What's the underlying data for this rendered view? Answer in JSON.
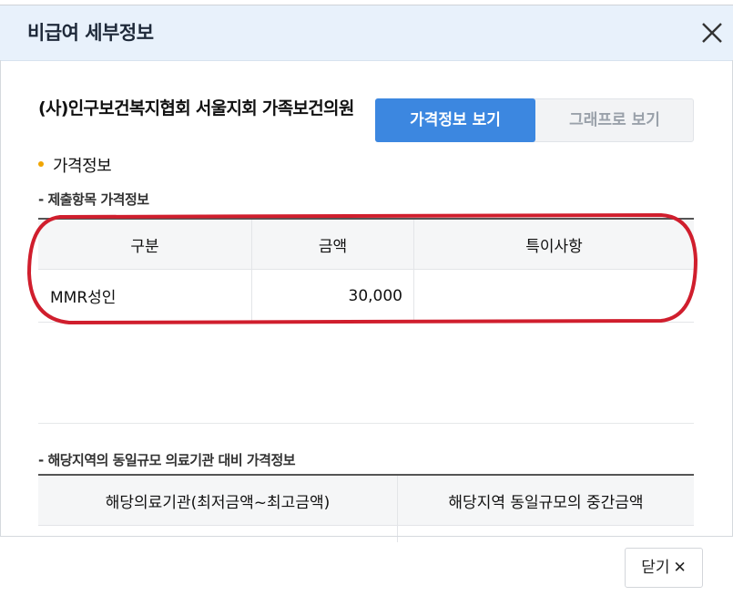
{
  "modal": {
    "title": "비급여 세부정보",
    "close_icon": "close-icon",
    "footer_close_label": "닫기",
    "footer_close_glyph": "✕"
  },
  "institution": {
    "name": "(사)인구보건복지협회 서울지회 가족보건의원"
  },
  "view_toggle": {
    "active_label": "가격정보 보기",
    "inactive_label": "그래프로 보기",
    "active_color": "#3c87e0"
  },
  "price_section": {
    "heading": "가격정보",
    "submitted": {
      "subheading": "- 제출항목 가격정보",
      "columns": [
        "구분",
        "금액",
        "특이사항"
      ],
      "rows": [
        {
          "category": "MMR성인",
          "amount": "30,000",
          "note": ""
        }
      ]
    },
    "regional": {
      "subheading": "- 해당지역의 동일규모 의료기관 대비 가격정보",
      "columns": [
        "해당의료기관(최저금액~최고금액)",
        "해당지역 동일규모의 중간금액"
      ]
    }
  }
}
